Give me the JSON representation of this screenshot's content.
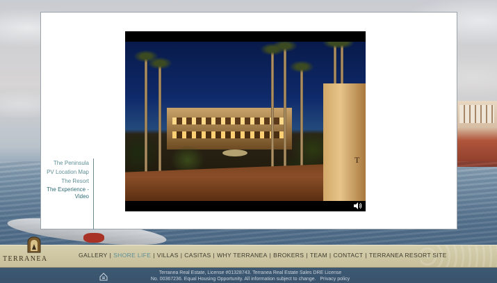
{
  "subnav": {
    "items": [
      {
        "label": "The Peninsula"
      },
      {
        "label": "PV Location Map"
      },
      {
        "label": "The Resort"
      },
      {
        "label": "The Experience -",
        "label2": "Video"
      }
    ]
  },
  "video": {
    "overlay_text": "T",
    "controls": {
      "volume_icon": "speaker-icon"
    }
  },
  "logo": {
    "wordmark": "TERRANEA",
    "emblem_icon": "terranea-crest-icon"
  },
  "nav": {
    "items": [
      {
        "label": "GALLERY"
      },
      {
        "label": "SHORE LIFE"
      },
      {
        "label": "VILLAS"
      },
      {
        "label": "CASITAS"
      },
      {
        "label": "WHY TERRANEA"
      },
      {
        "label": "BROKERS"
      },
      {
        "label": "TEAM"
      },
      {
        "label": "CONTACT"
      },
      {
        "label": "TERRANEA RESORT SITE"
      }
    ],
    "separator": "|",
    "current": "SHORE LIFE"
  },
  "footer": {
    "line1": "Terranea Real Estate, License #01328743. Terranea Real Estate Sales DRE License",
    "line2": "No. 00367236. Equal Housing Opportunity.  All information subject to change.",
    "privacy_label": "Privacy policy",
    "eho_icon": "equal-housing-icon"
  },
  "colors": {
    "accent": "#5f8f96",
    "nav_bar": "#d6cfae",
    "nav_text": "#3e3a2e"
  }
}
